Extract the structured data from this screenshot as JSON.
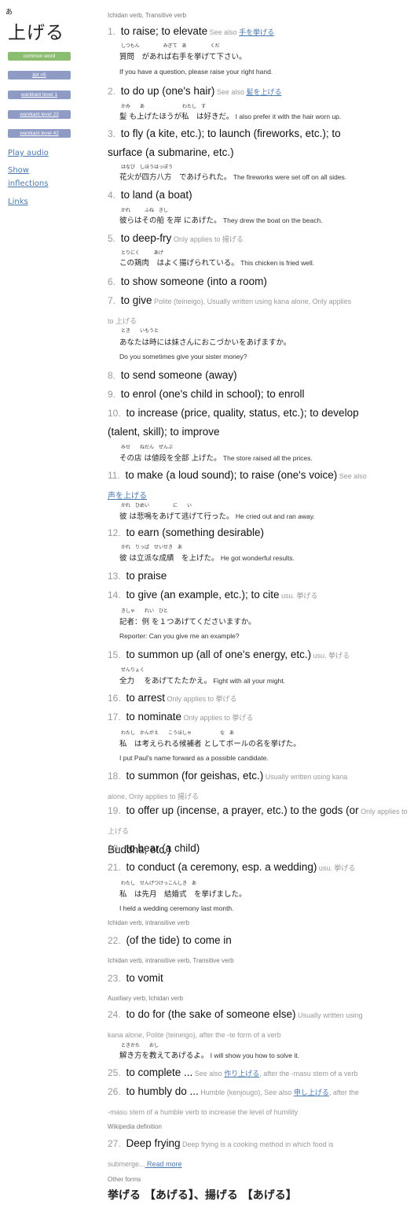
{
  "word": {
    "furigana": "あ",
    "text": "上げる"
  },
  "tags": [
    "common word",
    "jlpt n5",
    "wanikani level 1",
    "wanikani level 23",
    "wanikani level 42"
  ],
  "links": {
    "play_audio": "Play audio",
    "show_inflections_1": "Show",
    "show_inflections_2": "inflections",
    "links": "Links"
  },
  "pos": {
    "p1": "Ichidan verb, Transitive verb",
    "p2": "Ichidan verb, intransitive verb",
    "p3": "Ichidan verb, intransitive verb, Transitive verb",
    "p4": "Auxiliary verb, Ichidan verb",
    "p5": "Wikipedia definition",
    "p6": "Other forms"
  },
  "senses": [
    {
      "n": "1.",
      "t": "to raise; to elevate",
      "note": "See also ",
      "link": "手を挙げる"
    },
    {
      "n": "2.",
      "t": "to do up (one's hair)",
      "note": "See also ",
      "link": "髪を上げる"
    },
    {
      "n": "3.",
      "t": "to fly (a kite, etc.); to launch (fireworks, etc.); to",
      "t2": "surface (a submarine, etc.)"
    },
    {
      "n": "4.",
      "t": "to land (a boat)"
    },
    {
      "n": "5.",
      "t": "to deep-fry",
      "note": "Only applies to 揚げる"
    },
    {
      "n": "6.",
      "t": "to show someone (into a room)"
    },
    {
      "n": "7.",
      "t": "to give",
      "note": "Polite (teineigo), Usually written using kana alone, Only applies",
      "note2": "to 上げる"
    },
    {
      "n": "8.",
      "t": "to send someone (away)"
    },
    {
      "n": "9.",
      "t": "to enrol (one's child in school); to enroll"
    },
    {
      "n": "10.",
      "t": "to increase (price, quality, status, etc.); to develop",
      "t2": "(talent, skill); to improve"
    },
    {
      "n": "11.",
      "t": "to make (a loud sound); to raise (one's voice)",
      "note": "See also",
      "link2": "声を上げる"
    },
    {
      "n": "12.",
      "t": "to earn (something desirable)"
    },
    {
      "n": "13.",
      "t": "to praise"
    },
    {
      "n": "14.",
      "t": "to give (an example, etc.); to cite",
      "note": "usu. 挙げる"
    },
    {
      "n": "15.",
      "t": "to summon up (all of one's energy, etc.)",
      "note": "usu. 挙げる"
    },
    {
      "n": "16.",
      "t": "to arrest",
      "note": "Only applies to 挙げる"
    },
    {
      "n": "17.",
      "t": "to nominate",
      "note": "Only applies to 挙げる"
    },
    {
      "n": "18.",
      "t": "to summon (for geishas, etc.)",
      "note": "Usually written using kana",
      "note2": "alone, Only applies to 揚げる"
    },
    {
      "n": "19.",
      "t": "to offer up (incense, a prayer, etc.) to the gods (or",
      "t2": "Buddha, etc.)",
      "note": "Only applies to 上げる"
    },
    {
      "n": "20.",
      "t": "to bear (a child)"
    },
    {
      "n": "21.",
      "t": "to conduct (a ceremony, esp. a wedding)",
      "note": "usu. 挙げる"
    },
    {
      "n": "22.",
      "t": "(of the tide) to come in"
    },
    {
      "n": "23.",
      "t": "to vomit"
    },
    {
      "n": "24.",
      "t": "to do for (the sake of someone else)",
      "note": "Usually written using",
      "note2": "kana alone, Polite (teineigo), after the -te form of a verb"
    },
    {
      "n": "25.",
      "t": "to complete ...",
      "note": "See also ",
      "link": "作り上げる",
      "note3": ", after the -masu stem of a verb"
    },
    {
      "n": "26.",
      "t": "to humbly do ...",
      "note": "Humble (kenjougo), See also ",
      "link": "申し上げる",
      "note3": ", after the",
      "note2": "-masu stem of a humble verb to increase the level of humility"
    },
    {
      "n": "27.",
      "t": "Deep frying",
      "note": "Deep frying is a cooking method in which food is",
      "note2": "submerge...",
      "link3": " Read more"
    }
  ],
  "examples": {
    "e1": {
      "furi": "しつもん　　　　　みぎて　あ　　　　　くだ",
      "jp": "質問　があれば右手を挙げて下さい。",
      "en": "If you have a question, please raise your right hand."
    },
    "e2": {
      "furi": "かみ　　あ　　　　　　　　わたし　す",
      "jp": "髪 も上げたほうが私　は好きだ。",
      "en": "I also prefer it with the hair worn up."
    },
    "e3": {
      "furi": "はなび　しほうはっぽう",
      "jp": "花火が四方八方　であげられた。",
      "en": "The fireworks were set off on all sides."
    },
    "e4": {
      "furi": "かれ　　　ふね　きし",
      "jp": "彼らはその船 を岸 にあげた。",
      "en": "They drew the boat on the beach."
    },
    "e5": {
      "furi": "とりにく　　　あげ",
      "jp": "この鶏肉　はよく揚げられている。",
      "en": "This chicken is fried well."
    },
    "e7": {
      "furi": "とき　　いもうと",
      "jp": "あなたは時には妹さんにおこづかいをあげますか。",
      "en": "Do you sometimes give your sister money?"
    },
    "e10": {
      "furi": "みせ　　ねだん　ぜんぶ",
      "jp": "その店 は値段を全部 上げた。",
      "en": "The store raised all the prices."
    },
    "e11": {
      "furi": "かれ　ひめい　　　　　に　　い",
      "jp": "彼 は悲鳴をあげて逃げて行った。",
      "en": "He cried out and ran away."
    },
    "e12": {
      "furi": "かれ　りっぱ　せいせき　あ",
      "jp": "彼 は立派な成績　を上げた。",
      "en": "He got wonderful results."
    },
    "e14": {
      "furi": "きしゃ　　れい　ひと",
      "jp": "記者：例 を１つあげてくださいますか。",
      "en": "Reporter: Can you give me an example?"
    },
    "e15": {
      "furi": "ぜんりょく",
      "jp": "全力　 をあげてたたかえ。",
      "en": "Fight with all your might."
    },
    "e17": {
      "furi": "わたし　かんがえ　　こうほしゃ　　　　　　な　あ",
      "jp": "私　は考えられる候補者 としてポールの名を挙げた。",
      "en": "I put Paul's name forward as a possible candidate."
    },
    "e21": {
      "furi": "わたし　せんげつけっこんしき　あ",
      "jp": "私　は先月　結婚式　を挙げました。",
      "en": "I held a wedding ceremony last month."
    },
    "e24": {
      "furi": "ときかた　　おし",
      "jp": "解き方を教えてあげるよ。",
      "en": "I will show you how to solve it."
    }
  },
  "other_forms": "挙げる 【あげる】、揚げる 【あげる】"
}
